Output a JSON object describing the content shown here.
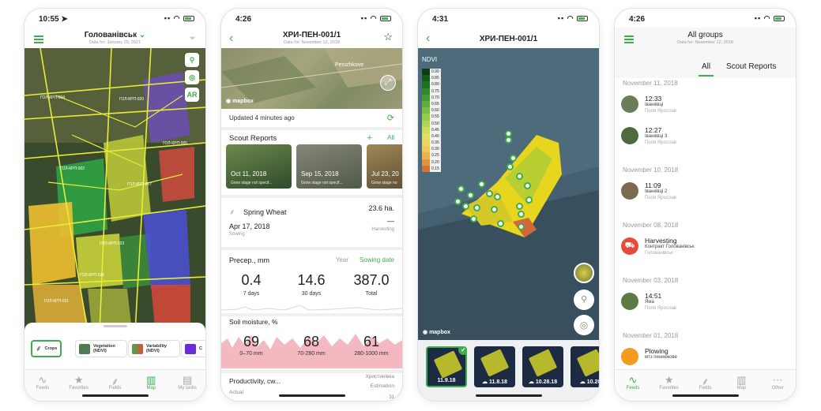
{
  "phone1": {
    "time": "10:55",
    "title": "Голованівськ",
    "subtitle": "Data for: January 20, 2021",
    "fab_ar": "AR",
    "field_labels": [
      "ГОЛ-КРП-004",
      "ГОЛ-КРП-002",
      "ГОЛ-КРП-007",
      "ГОЛ-КРП-023",
      "ГОЛ-КРП-025",
      "ГОЛ-КРП-031",
      "ГОЛ-КРП-020",
      "ГОЛ-КРП-005"
    ],
    "layers": [
      {
        "label": "Crops",
        "color": "#3cae4b"
      },
      {
        "label": "Vegetation (NDVI)",
        "color": "#4f7d53"
      },
      {
        "label": "Variability (NDVI)",
        "color": "#e04b3c"
      },
      {
        "label": "C",
        "color": "#6a2bd9"
      }
    ],
    "tabs": [
      {
        "label": "Feeds",
        "icon": "pulse-icon"
      },
      {
        "label": "Favorites",
        "icon": "star-icon"
      },
      {
        "label": "Fields",
        "icon": "wheat-icon"
      },
      {
        "label": "Map",
        "icon": "map-icon"
      },
      {
        "label": "My tasks",
        "icon": "clipboard-icon"
      }
    ],
    "active_tab": "Map"
  },
  "phone2": {
    "time": "4:26",
    "title": "ХРИ-ПЕН-001/1",
    "subtitle": "Data for: November 12, 2018",
    "map_place": "Penizhkove",
    "map_brand": "mapbox",
    "updated": "Updated 4 minutes ago",
    "scout_title": "Scout Reports",
    "scout_all": "All",
    "scout_cards": [
      {
        "date": "Oct 11, 2018",
        "stage": "Grow stage not specif..."
      },
      {
        "date": "Sep 15, 2018",
        "stage": "Grow stage not specif..."
      },
      {
        "date": "Jul 23, 20",
        "stage": "Grow stage no"
      }
    ],
    "crop": "Spring Wheat",
    "area": "23.6 ha.",
    "sowing_date": "Apr 17, 2018",
    "sowing_label": "Sowing",
    "harvest_value": "—",
    "harvest_label": "Harvesting",
    "precip_title": "Precep., mm",
    "precip_year": "Year",
    "precip_sowing": "Sowing date",
    "precip_values": [
      {
        "value": "0.4",
        "label": "7 days"
      },
      {
        "value": "14.6",
        "label": "30 days"
      },
      {
        "value": "387.0",
        "label": "Total"
      }
    ],
    "moisture_title": "Soil moisture, %",
    "moisture_values": [
      {
        "value": "69",
        "label": "0–70 mm"
      },
      {
        "value": "68",
        "label": "70-280 mm"
      },
      {
        "value": "61",
        "label": "280-1000 mm"
      }
    ],
    "productivity_title": "Productivity, cw...",
    "productivity_place": "Христинівка",
    "productivity_actual": "Actual",
    "productivity_estimation": "Estimation",
    "productivity_partial": "31"
  },
  "phone3": {
    "time": "4:31",
    "title": "ХРИ-ПЕН-001/1",
    "index": "NDVI",
    "scale_values": [
      "0.90",
      "0.85",
      "0.80",
      "0.75",
      "0.70",
      "0.65",
      "0.60",
      "0.55",
      "0.50",
      "0.45",
      "0.40",
      "0.35",
      "0.30",
      "0.25",
      "0.20",
      "0.15"
    ],
    "map_brand": "mapbox",
    "dates": [
      {
        "label": "11.9.18",
        "cloud": false,
        "selected": true
      },
      {
        "label": "11.8.18",
        "cloud": true,
        "selected": false
      },
      {
        "label": "10.28.18",
        "cloud": true,
        "selected": false
      },
      {
        "label": "10.20.",
        "cloud": true,
        "selected": false
      }
    ]
  },
  "phone4": {
    "time": "4:26",
    "title": "All groups",
    "subtitle": "Data for: November 12, 2018",
    "seg_all": "All",
    "seg_scout": "Scout Reports",
    "groups": [
      {
        "date": "November 11, 2018",
        "items": [
          {
            "title": "12:33",
            "line1": "Іванківці",
            "line2": "Поля Ярослав",
            "avatar": "#6b7d5a"
          },
          {
            "title": "12:27",
            "line1": "Іванківці 3",
            "line2": "Поля Ярослав",
            "avatar": "#4f6a3d"
          }
        ]
      },
      {
        "date": "November 10, 2018",
        "items": [
          {
            "title": "11:09",
            "line1": "Іванківці 2",
            "line2": "Поля Ярослав",
            "avatar": "#7b6a4d"
          }
        ]
      },
      {
        "date": "November 08, 2018",
        "items": [
          {
            "title": "Harvesting",
            "line1": "Контракт Голованівськ",
            "line2": "Голованівськ",
            "avatar": "#e54b3a"
          }
        ]
      },
      {
        "date": "November 03, 2018",
        "items": [
          {
            "title": "14:51",
            "line1": "Яма",
            "line2": "Поля Ярослав",
            "avatar": "#5c7a45"
          }
        ]
      },
      {
        "date": "November 01, 2018",
        "items": [
          {
            "title": "Plowing",
            "line1": "мтз пеникжове",
            "line2": "",
            "avatar": "#f29b1f"
          }
        ]
      }
    ],
    "tabs": [
      {
        "label": "Feeds",
        "icon": "pulse-icon"
      },
      {
        "label": "Favorites",
        "icon": "star-icon"
      },
      {
        "label": "Fields",
        "icon": "wheat-icon"
      },
      {
        "label": "Map",
        "icon": "map-icon"
      },
      {
        "label": "Other",
        "icon": "more-icon"
      }
    ],
    "active_tab": "Feeds"
  }
}
